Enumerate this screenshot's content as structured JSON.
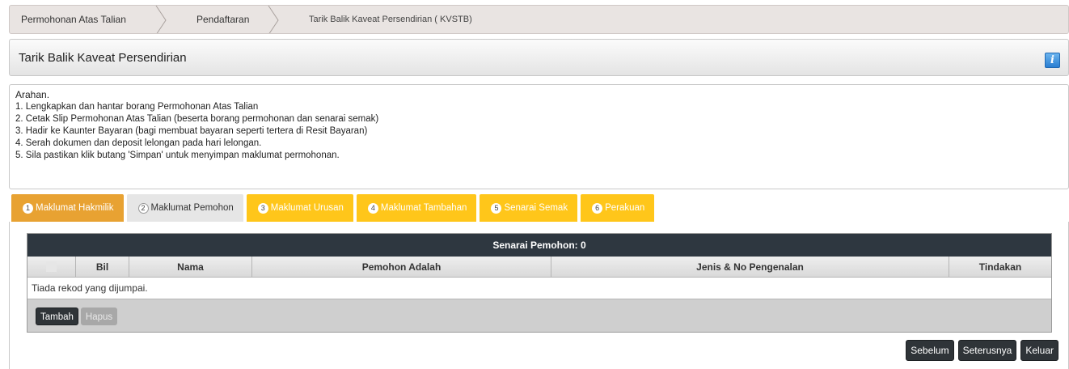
{
  "breadcrumb": {
    "items": [
      {
        "label": "Permohonan Atas Talian"
      },
      {
        "label": "Pendaftaran"
      },
      {
        "label": "Tarik Balik Kaveat Persendirian ( KVSTB)"
      }
    ]
  },
  "panel": {
    "title": "Tarik Balik Kaveat Persendirian",
    "info_icon": "i"
  },
  "instructions": {
    "title": "Arahan.",
    "lines": [
      "1. Lengkapkan dan hantar borang Permohonan Atas Talian",
      "2. Cetak Slip Permohonan Atas Talian (beserta borang permohonan dan senarai semak)",
      "3. Hadir ke Kaunter Bayaran (bagi membuat bayaran seperti tertera di Resit Bayaran)",
      "4. Serah dokumen dan deposit lelongan pada hari lelongan.",
      "5. Sila pastikan klik butang 'Simpan' untuk menyimpan maklumat permohonan."
    ]
  },
  "tabs": [
    {
      "num": "1",
      "label": "Maklumat Hakmilik",
      "state": "active"
    },
    {
      "num": "2",
      "label": "Maklumat Pemohon",
      "state": "selected"
    },
    {
      "num": "3",
      "label": "Maklumat Urusan",
      "state": "normal"
    },
    {
      "num": "4",
      "label": "Maklumat Tambahan",
      "state": "normal"
    },
    {
      "num": "5",
      "label": "Senarai Semak",
      "state": "normal"
    },
    {
      "num": "6",
      "label": "Perakuan",
      "state": "normal"
    }
  ],
  "grid": {
    "caption": "Senarai Pemohon: 0",
    "columns": [
      "",
      "Bil",
      "Nama",
      "Pemohon Adalah",
      "Jenis & No Pengenalan",
      "Tindakan"
    ],
    "empty_message": "Tiada rekod yang dijumpai.",
    "add_label": "Tambah",
    "delete_label": "Hapus"
  },
  "nav": {
    "prev_label": "Sebelum",
    "next_label": "Seterusnya",
    "exit_label": "Keluar"
  },
  "colors": {
    "tab_active": "#e8a232",
    "tab_normal": "#ffc61a",
    "grid_caption": "#2e3740",
    "button_dark": "#2f3438"
  }
}
